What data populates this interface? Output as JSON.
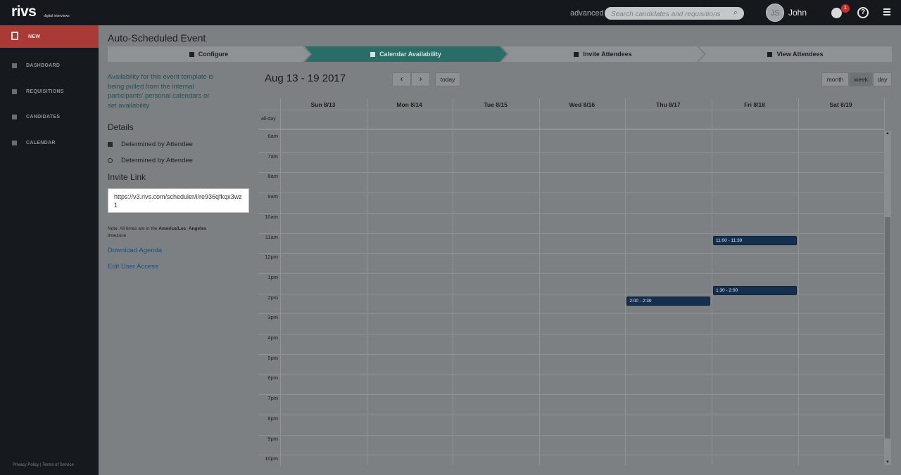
{
  "topbar": {
    "logo": "rivs",
    "logo_sub": "digital interviews",
    "advanced": "advanced",
    "search_placeholder": "Search candidates and requisitions",
    "avatar_initials": "JS",
    "user_name": "John",
    "notification_count": "1",
    "help_glyph": "?"
  },
  "sidebar": {
    "new_label": "NEW",
    "items": [
      {
        "label": "DASHBOARD",
        "icon": "bar-chart-icon"
      },
      {
        "label": "REQUISITIONS",
        "icon": "document-icon"
      },
      {
        "label": "CANDIDATES",
        "icon": "person-icon"
      },
      {
        "label": "CALENDAR",
        "icon": "calendar-icon"
      }
    ],
    "footer": "Privacy Policy | Terms of Service"
  },
  "page": {
    "title": "Auto-Scheduled Event",
    "steps": [
      {
        "label": "Configure",
        "icon": "wrench-icon"
      },
      {
        "label": "Calendar Availability",
        "icon": "calendar-icon"
      },
      {
        "label": "Invite Attendees",
        "icon": "plus-icon"
      },
      {
        "label": "View Attendees",
        "icon": "list-icon"
      }
    ],
    "active_step": 1
  },
  "info": {
    "availability_text": "Availability for this event template is being pulled from the internal participants' personal calendars or set availability",
    "details_heading": "Details",
    "detail_date": "Determined by Attendee",
    "detail_time": "Determined by Attendee",
    "invite_heading": "Invite Link",
    "invite_url": "https://v3.rivs.com/scheduler/i/re936qfkqx3wz1",
    "note_prefix": "Note: All times are in the ",
    "note_tz": "America/Los_Angeles",
    "note_suffix": " timezone",
    "download_agenda": "Download Agenda",
    "edit_user_access": "Edit User Access"
  },
  "calendar": {
    "range_title": "Aug 13 - 19 2017",
    "prev": "‹",
    "next": "›",
    "today": "today",
    "views": {
      "month": "month",
      "week": "week",
      "day": "day"
    },
    "active_view": "week",
    "days": [
      "Sun 8/13",
      "Mon 8/14",
      "Tue 8/15",
      "Wed 8/16",
      "Thu 8/17",
      "Fri 8/18",
      "Sat 8/19"
    ],
    "all_day_label": "all-day",
    "hours": [
      "6am",
      "7am",
      "8am",
      "9am",
      "10am",
      "11am",
      "12pm",
      "1pm",
      "2pm",
      "3pm",
      "4pm",
      "5pm",
      "6pm",
      "7pm",
      "8pm",
      "9pm",
      "10pm"
    ],
    "events": [
      {
        "label": "11:00 - 11:30",
        "day": "Fri 8/18",
        "start": "11:00",
        "end": "11:30"
      },
      {
        "label": "1:30 - 2:00",
        "day": "Fri 8/18",
        "start": "13:30",
        "end": "14:00"
      },
      {
        "label": "2:00 - 2:30",
        "day": "Thu 8/17",
        "start": "14:00",
        "end": "14:30"
      }
    ],
    "event_color": "#15304e"
  }
}
